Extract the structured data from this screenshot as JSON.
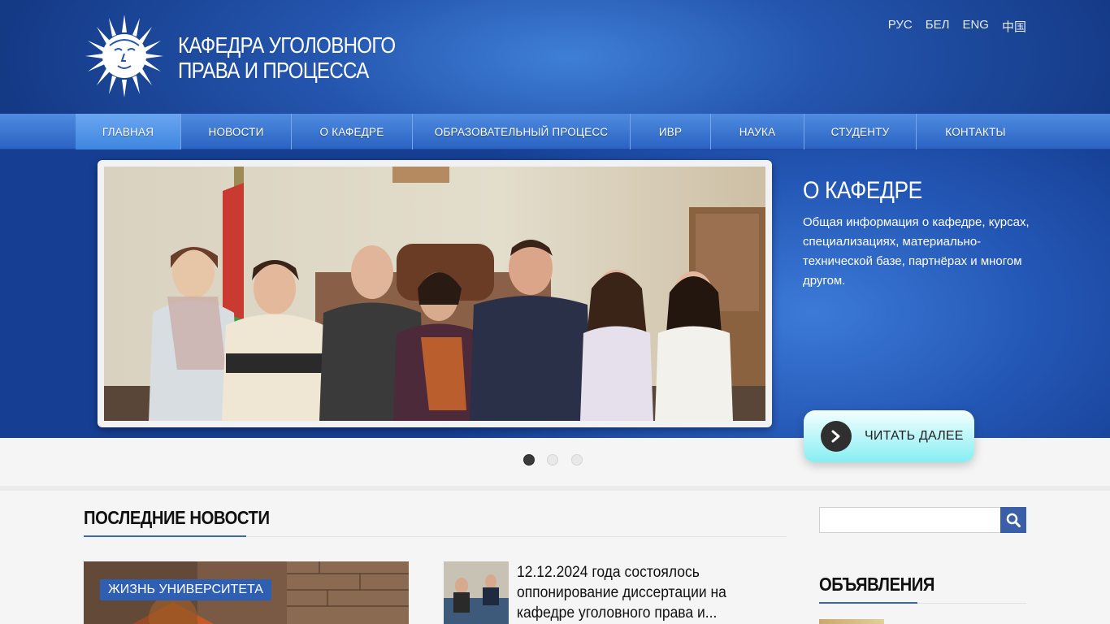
{
  "header": {
    "title_line1": "КАФЕДРА УГОЛОВНОГО",
    "title_line2": "ПРАВА И ПРОЦЕССА",
    "logo_icon": "sun-face-logo-icon"
  },
  "languages": [
    "РУС",
    "БЕЛ",
    "ENG",
    "中国"
  ],
  "nav": {
    "items": [
      {
        "label": "ГЛАВНАЯ",
        "active": true
      },
      {
        "label": "НОВОСТИ",
        "active": false
      },
      {
        "label": "О КАФЕДРЕ",
        "active": false
      },
      {
        "label": "ОБРАЗОВАТЕЛЬНЫЙ ПРОЦЕСС",
        "active": false
      },
      {
        "label": "ИВР",
        "active": false
      },
      {
        "label": "НАУКА",
        "active": false
      },
      {
        "label": "СТУДЕНТУ",
        "active": false
      },
      {
        "label": "КОНТАКТЫ",
        "active": false
      }
    ]
  },
  "hero": {
    "title": "О КАФЕДРЕ",
    "description": "Общая информация о кафедре, курсах, специализациях, материально-технической базе, партнёрах и многом другом.",
    "read_more_label": "ЧИТАТЬ ДАЛЕЕ",
    "read_more_icon": "chevron-right-icon",
    "slide_count": 3,
    "active_slide": 1
  },
  "news": {
    "section_title": "ПОСЛЕДНИЕ НОВОСТИ",
    "featured_category": "ЖИЗНЬ УНИВЕРСИТЕТА",
    "item_title": "12.12.2024 года состоялось оппонирование диссертации на кафедре уголовного права и..."
  },
  "sidebar": {
    "search_placeholder": "",
    "search_icon": "search-icon",
    "announcements_title": "ОБЪЯВЛЕНИЯ"
  },
  "colors": {
    "header_blue": "#2455ae",
    "nav_blue": "#3a74d4",
    "accent_blue": "#3a5ea8",
    "read_more_cyan": "#86eef2"
  }
}
